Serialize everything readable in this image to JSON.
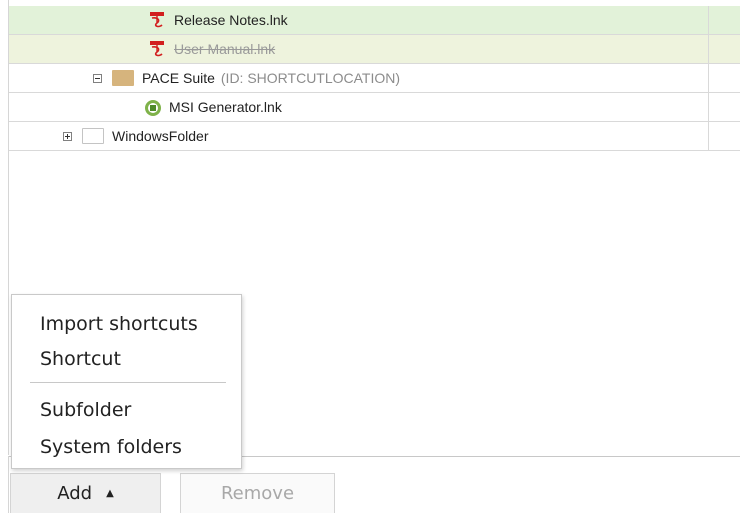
{
  "tree": {
    "rows": [
      {
        "label": "Release Notes.lnk",
        "icon": "pdf-shortcut-icon",
        "state": "added",
        "color": "#e2f2d9"
      },
      {
        "label": "User Manual.lnk",
        "icon": "pdf-shortcut-icon",
        "state": "removed",
        "color": "#eef3dd"
      },
      {
        "label": "PACE Suite",
        "id_text": "(ID: SHORTCUTLOCATION)",
        "icon": "folder-icon",
        "expander": "minus"
      },
      {
        "label": "MSI Generator.lnk",
        "icon": "msi-generator-icon"
      },
      {
        "label": "WindowsFolder",
        "icon": "empty-folder-icon",
        "expander": "plus"
      }
    ]
  },
  "menu": {
    "items": [
      "Import shortcuts",
      "Shortcut",
      "Subfolder",
      "System folders"
    ]
  },
  "buttons": {
    "add_label": "Add",
    "add_caret": "▲",
    "remove_label": "Remove"
  }
}
